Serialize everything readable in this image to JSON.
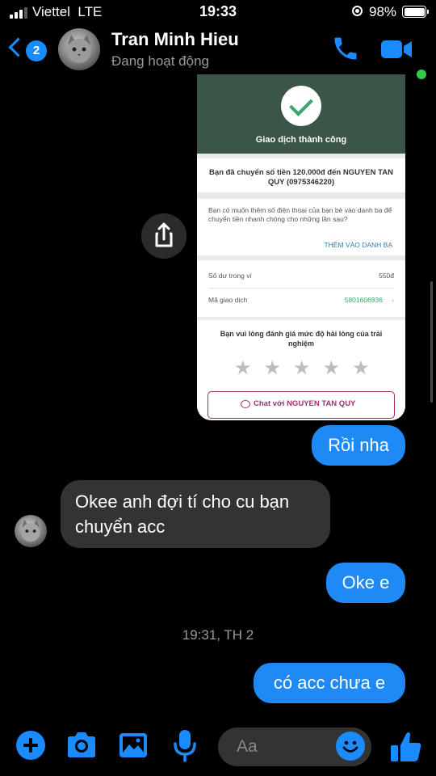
{
  "status_bar": {
    "carrier": "Viettel",
    "network": "LTE",
    "time": "19:33",
    "battery": "98%"
  },
  "header": {
    "unread_count": "2",
    "contact_name": "Tran Minh Hieu",
    "presence": "Đang hoạt động"
  },
  "receipt": {
    "title": "Giao dịch thành công",
    "message": "Bạn đã chuyển số tiền 120.000đ đến NGUYEN TAN QUY (0975346220)",
    "question": "Bạn có muốn thêm số điện thoại của bạn bè vào danh bạ để chuyển tiền nhanh chóng cho những lần sau?",
    "add_link": "THÊM VÀO DANH BẠ",
    "balance_label": "Số dư trong ví",
    "balance_value": "550đ",
    "tx_label": "Mã giao dịch",
    "tx_value": "5801606936",
    "rating_prompt": "Bạn vui lòng đánh giá mức độ hài lòng của trải nghiệm",
    "rating_stars": 0,
    "chat_button": "Chat với NGUYEN TAN QUY"
  },
  "messages": [
    {
      "from": "me",
      "text": "Rồi nha"
    },
    {
      "from": "them",
      "text": "Okee anh đợi tí cho cu bạn chuyển acc"
    },
    {
      "from": "me",
      "text": "Oke e"
    },
    {
      "type": "timestamp",
      "text": "19:31, TH 2"
    },
    {
      "from": "me",
      "text": "có acc chưa e"
    }
  ],
  "composer": {
    "placeholder": "Aa"
  },
  "colors": {
    "accent": "#1a8cff",
    "outgoing_bubble": "#1f89f5",
    "incoming_bubble": "#333335",
    "receipt_header": "#3b5648",
    "receipt_accent": "#a0306b",
    "online": "#31cc46"
  },
  "icons": [
    "back-chevron-icon",
    "phone-icon",
    "video-camera-icon",
    "share-icon",
    "plus-icon",
    "camera-icon",
    "image-icon",
    "microphone-icon",
    "emoji-icon",
    "thumbs-up-icon"
  ]
}
